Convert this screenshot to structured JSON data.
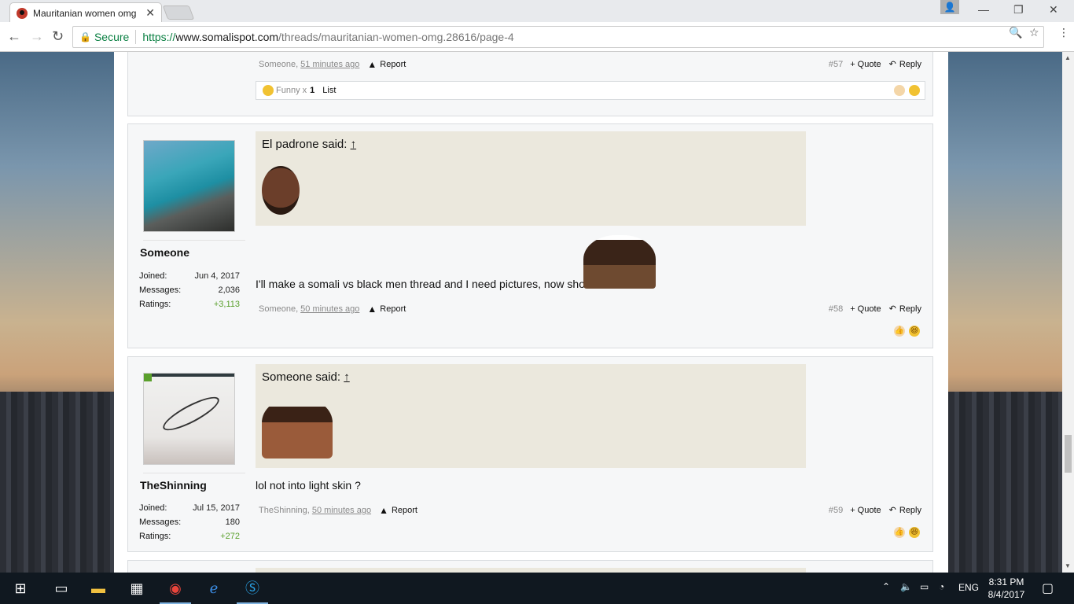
{
  "browser": {
    "tab_title": "Mauritanian women omg",
    "secure_label": "Secure",
    "url_scheme": "https://",
    "url_host": "www.somalispot.com",
    "url_path": "/threads/mauritanian-women-omg.28616/page-4"
  },
  "post57": {
    "author": "Someone",
    "time": "51 minutes ago",
    "report": "Report",
    "num": "#57",
    "quote": "+ Quote",
    "reply": "Reply",
    "rating_label": "Funny x",
    "rating_count": "1",
    "rating_list": "List"
  },
  "post58": {
    "username": "Someone",
    "joined_label": "Joined:",
    "joined": "Jun 4, 2017",
    "messages_label": "Messages:",
    "messages": "2,036",
    "ratings_label": "Ratings:",
    "ratings": "+3,113",
    "quote_author": "El padrone said:",
    "quote_arrow": "↑",
    "text": "I'll make a somali vs black men thread and I need pictures, now shoo",
    "author": "Someone",
    "time": "50 minutes ago",
    "report": "Report",
    "num": "#58",
    "quote": "+ Quote",
    "reply": "Reply"
  },
  "post59": {
    "username": "TheShinning",
    "joined_label": "Joined:",
    "joined": "Jul 15, 2017",
    "messages_label": "Messages:",
    "messages": "180",
    "ratings_label": "Ratings:",
    "ratings": "+272",
    "quote_author": "Someone said:",
    "quote_arrow": "↑",
    "text": "lol not into light skin ?",
    "author": "TheShinning",
    "time": "50 minutes ago",
    "report": "Report",
    "num": "#59",
    "quote": "+ Quote",
    "reply": "Reply"
  },
  "taskbar": {
    "lang": "ENG",
    "time": "8:31 PM",
    "date": "8/4/2017"
  }
}
